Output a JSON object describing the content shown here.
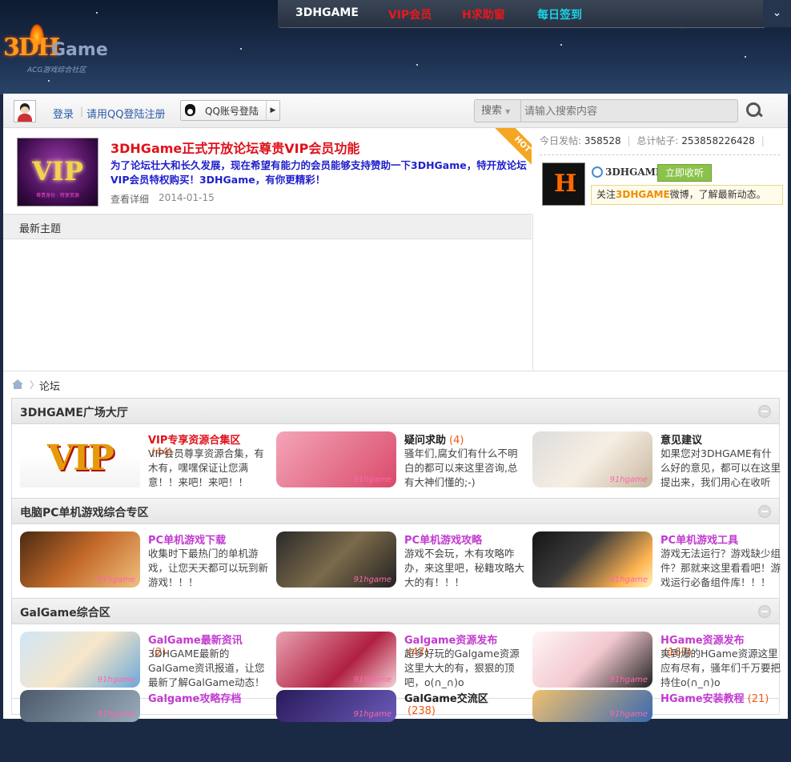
{
  "topnav": {
    "brand": "3DHGAME",
    "vip": "VIP会员",
    "hgame": "H求助窗",
    "signin": "每日签到"
  },
  "logo": {
    "mark": "3DH",
    "game": "Game",
    "subtitle": "ACG游戏综合社区"
  },
  "userbar": {
    "login": "登录",
    "qq_register": "请用QQ登陆注册",
    "qq_button": "QQ账号登陆",
    "search_scope": "搜索",
    "search_placeholder": "请输入搜索内容"
  },
  "notice": {
    "image_text": "VIP",
    "image_caption": "尊贵身份 · 特享资源",
    "title": "3DHGame正式开放论坛尊贵VIP会员功能",
    "desc": "为了论坛壮大和长久发展，现在希望有能力的会员能够支持赞助一下3DHGame，特开放论坛VIP会员特权购买！3DHGame，有你更精彩！",
    "more": "查看详细",
    "date": "2014-01-15",
    "badge": "HOT"
  },
  "stats": {
    "today_label": "今日发帖:",
    "today": "358528",
    "total_label": "总计帖子:",
    "total": "253858226428"
  },
  "weibo": {
    "name": "3DHGAME",
    "follow": "立即收听",
    "tip_prefix": "关注",
    "tip_highlight": "3DHGAME",
    "tip_suffix": "微博，了解最新动态。"
  },
  "latest": {
    "title": "最新主题"
  },
  "breadcrumb": {
    "sep": "〉",
    "current": "论坛"
  },
  "sections": [
    {
      "title": "3DHGAME广场大厅",
      "forums": [
        {
          "name": "VIP专享资源合集区",
          "count": "(44)",
          "desc": "VIP会员尊享资源合集，有木有，嘿嘿保证让您满意！！来吧！来吧！！",
          "red": true
        },
        {
          "name": "疑问求助",
          "count": "(4)",
          "desc": "骚年们,腐女们有什么不明白的都可以来这里咨询,总有大神们懂的;-)",
          "black": true
        },
        {
          "name": "意见建议",
          "count": "",
          "desc": "如果您对3DHGAME有什么好的意见，都可以在这里提出来，我们用心在收听",
          "black": true
        }
      ]
    },
    {
      "title": "电脑PC单机游戏综合专区",
      "forums": [
        {
          "name": "PC单机游戏下载",
          "count": "",
          "desc": "收集时下最热门的单机游戏，让您天天都可以玩到新游戏！！！"
        },
        {
          "name": "PC单机游戏攻略",
          "count": "",
          "desc": "游戏不会玩，木有攻略咋办，来这里吧，秘籍攻略大大的有！！！"
        },
        {
          "name": "PC单机游戏工具",
          "count": "",
          "desc": "游戏无法运行？游戏缺少组件？那就来这里看看吧！游戏运行必备组件库！！！"
        }
      ]
    },
    {
      "title": "GalGame综合区",
      "forums": [
        {
          "name": "GalGame最新资讯",
          "count": "(2)",
          "desc": "3DHGAME最新的GalGame资讯报道，让您最新了解GalGame动态！"
        },
        {
          "name": "Galgame资源发布",
          "count": "(47)",
          "desc": "超多好玩的Galgame资源这里大大的有，狠狠的顶吧，o(∩_∩)o"
        },
        {
          "name": "HGame资源发布",
          "count": "(167)",
          "desc": "爽到爆的HGame资源这里应有尽有，骚年们千万要把持住o(∩_∩)o"
        }
      ]
    },
    {
      "forums": [
        {
          "name": "Galgame攻略存档",
          "count": "",
          "desc": ""
        },
        {
          "name": "GalGame交流区",
          "count": "(238)",
          "desc": "",
          "black": true
        },
        {
          "name": "HGame安装教程",
          "count": "(21)",
          "desc": ""
        }
      ]
    }
  ],
  "watermark": "91hgame",
  "colors": {
    "forum_name": "#c23ad0",
    "count": "#f25a12",
    "notice_title": "#e0101a"
  }
}
